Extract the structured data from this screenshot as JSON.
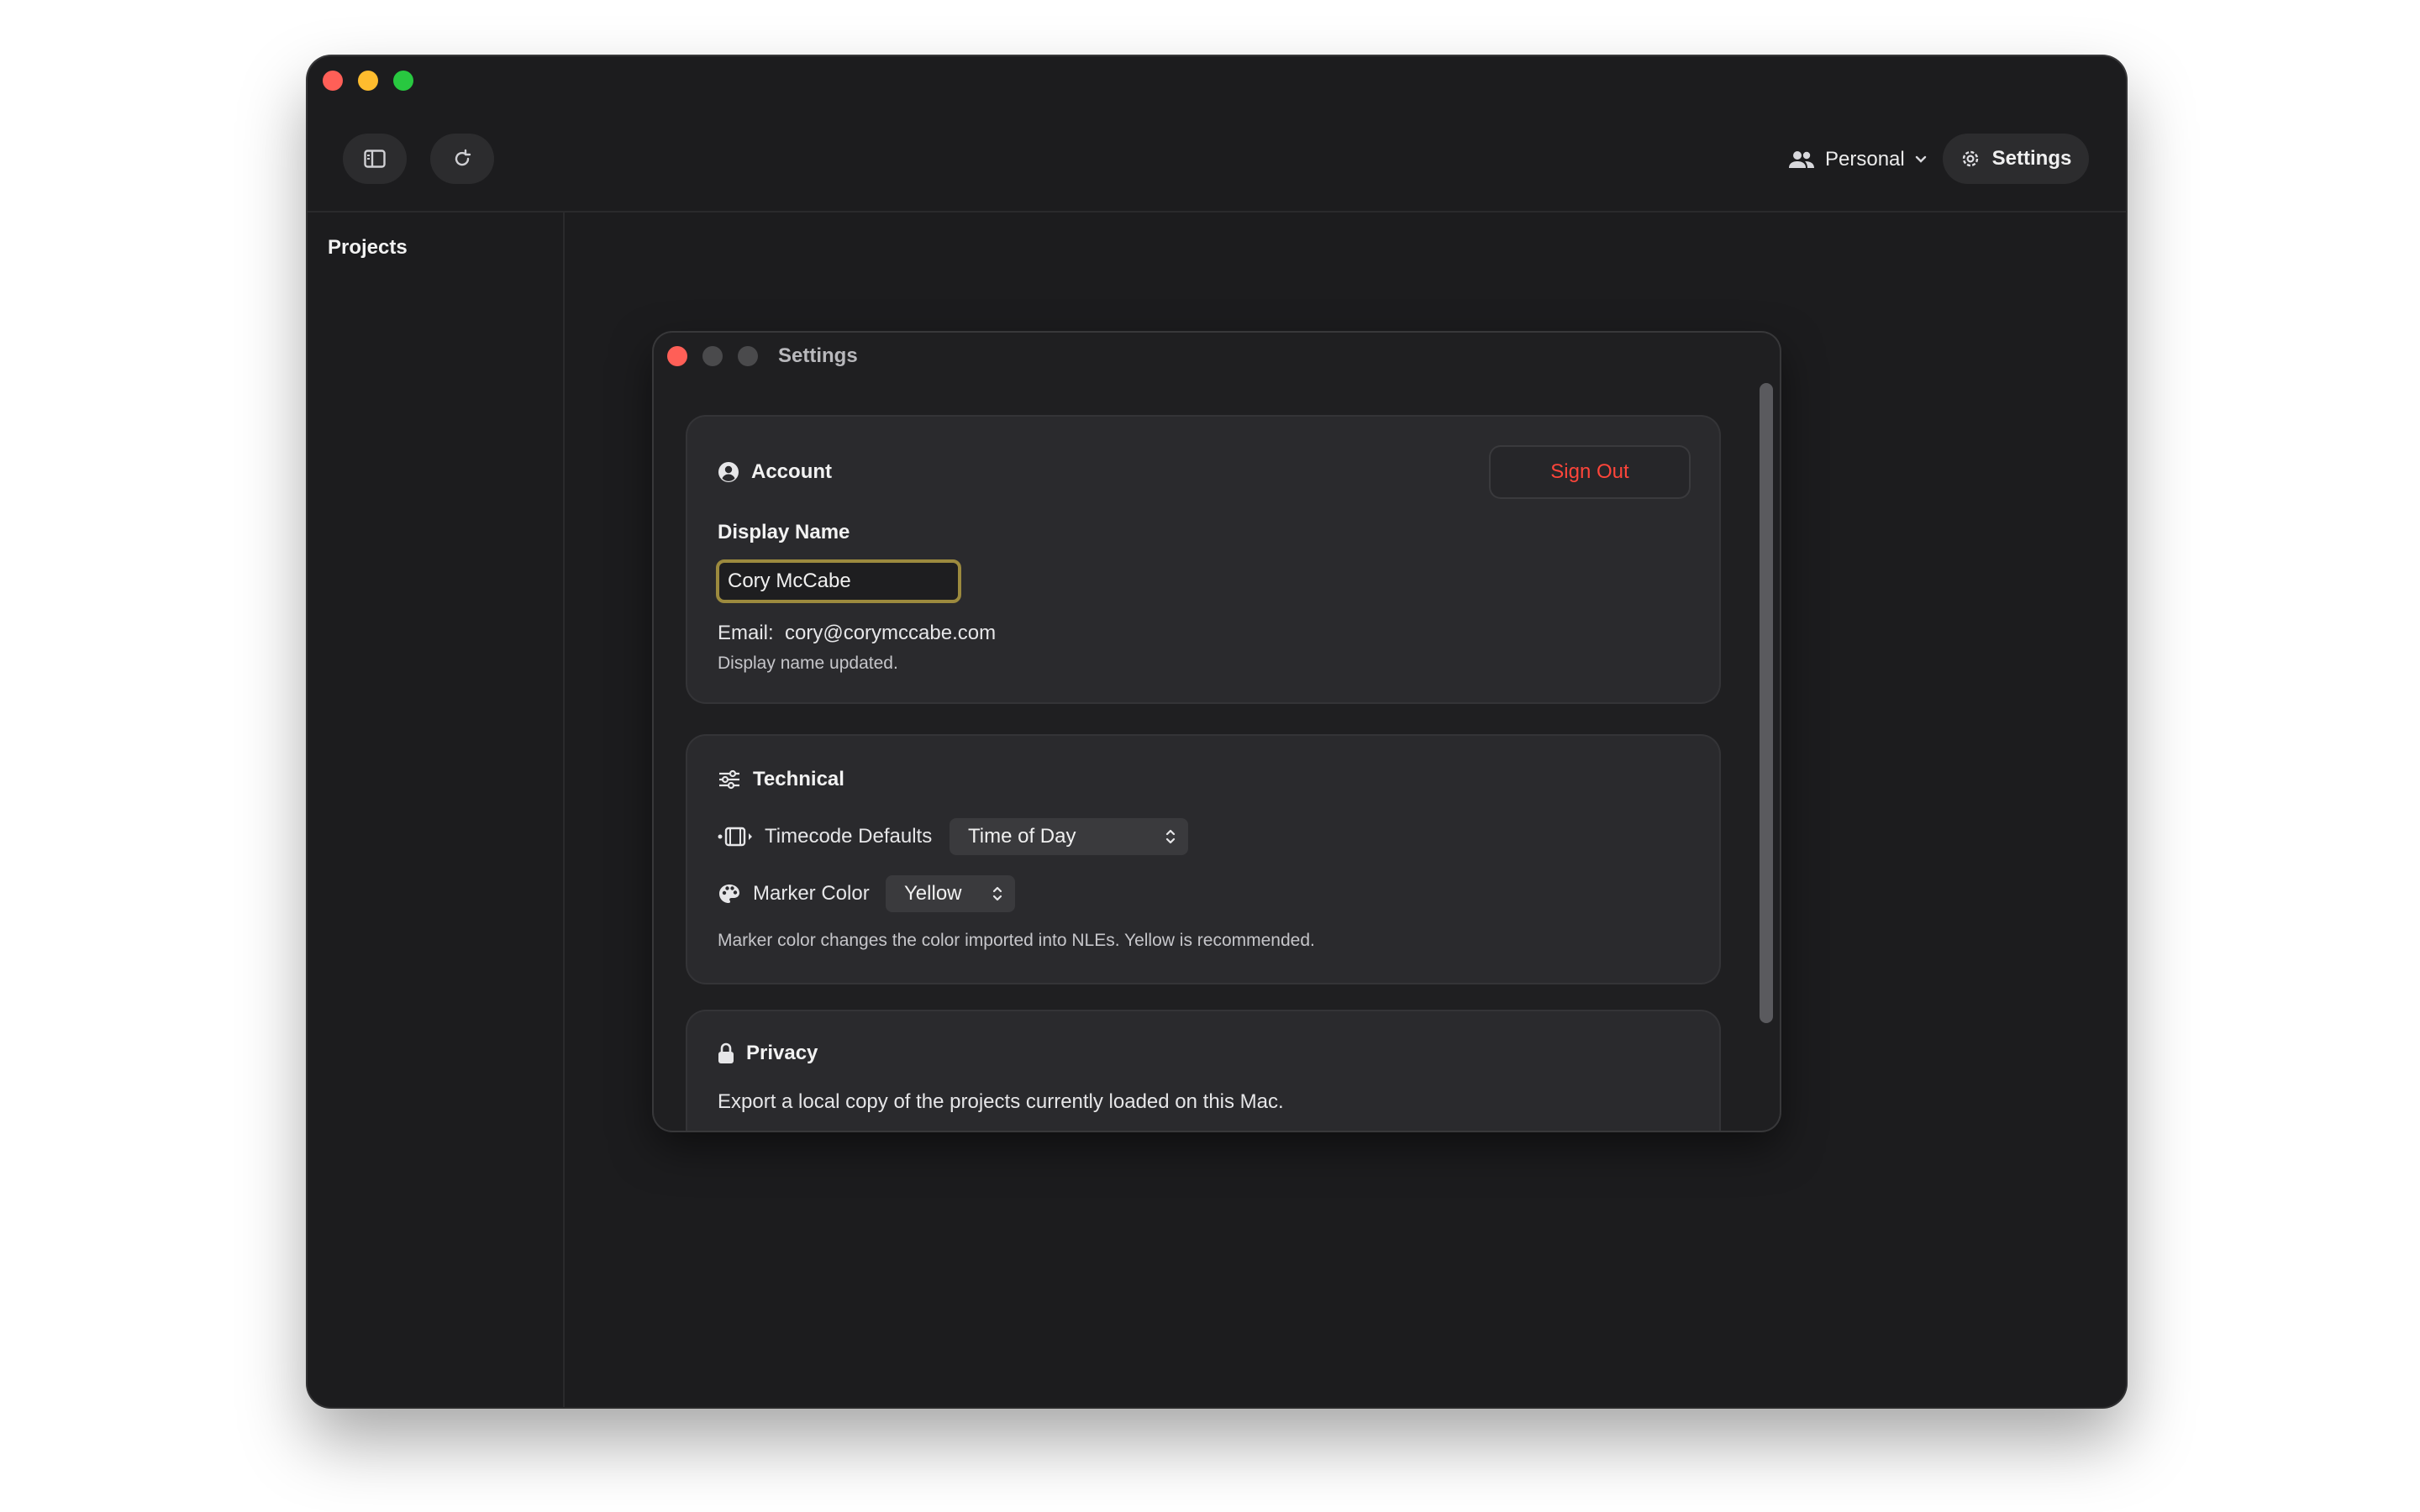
{
  "toolbar": {
    "account_switcher_label": "Personal",
    "settings_label": "Settings"
  },
  "sidebar": {
    "title": "Projects"
  },
  "dialog": {
    "title": "Settings",
    "account": {
      "heading": "Account",
      "sign_out_label": "Sign Out",
      "display_name_label": "Display Name",
      "display_name_value": "Cory McCabe",
      "email_label": "Email:",
      "email_value": "cory@corymccabe.com",
      "status_message": "Display name updated."
    },
    "technical": {
      "heading": "Technical",
      "timecode_label": "Timecode Defaults",
      "timecode_value": "Time of Day",
      "marker_label": "Marker Color",
      "marker_value": "Yellow",
      "help_text": "Marker color changes the color imported into NLEs. Yellow is recommended."
    },
    "privacy": {
      "heading": "Privacy",
      "description": "Export a local copy of the projects currently loaded on this Mac."
    }
  },
  "colors": {
    "sign_out": "#ff453a",
    "focus_ring": "#9c8a3e"
  }
}
